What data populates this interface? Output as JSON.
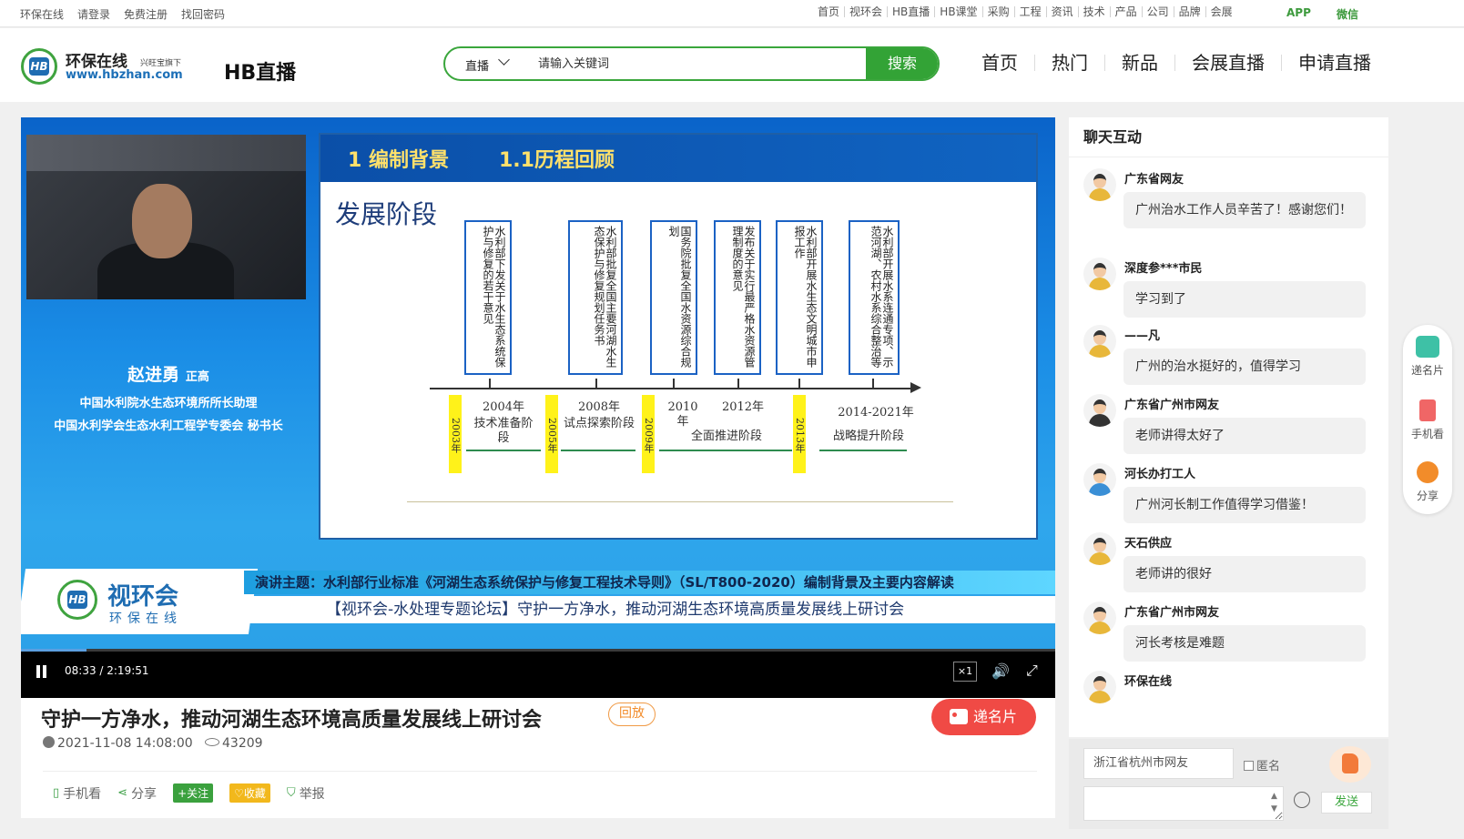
{
  "topbar": {
    "left_links": [
      "环保在线",
      "请登录",
      "免费注册",
      "找回密码"
    ],
    "right_links": [
      "首页",
      "视环会",
      "HB直播",
      "HB课堂",
      "采购",
      "工程",
      "资讯",
      "技术",
      "产品",
      "公司",
      "品牌",
      "会展"
    ],
    "app_label": "APP",
    "wechat_label": "微信"
  },
  "header": {
    "logo_name": "环保在线",
    "logo_sub": "兴旺宝旗下",
    "logo_url": "www.hbzhan.com",
    "section_title": "HB直播",
    "search": {
      "category": "直播",
      "placeholder": "请输入关键词",
      "button": "搜索"
    },
    "nav": [
      "首页",
      "热门",
      "新品",
      "会展直播",
      "申请直播"
    ]
  },
  "player": {
    "slide": {
      "heading1": "1 编制背景",
      "heading2": "1.1历程回顾",
      "stage_title": "发展阶段",
      "boxes": [
        "水利部下发关于水生态系统保护与修复的若干意见",
        "水利部批复全国主要河湖水生态保护与修复规划任务书",
        "国务院批复全国水资源综合规划",
        "发布关于实行最严格水资源管理制度的意见",
        "水利部开展水生态文明城市申报工作",
        "水利部开展水系连通专项、示范河湖、农村水系综合整治等"
      ],
      "years": [
        "2003年",
        "2005年",
        "2009年",
        "2013年"
      ],
      "phases": [
        {
          "year": "2004年",
          "name": "技术准备阶段"
        },
        {
          "year": "2008年",
          "name": "试点探索阶段"
        },
        {
          "year": "2010年",
          "name": ""
        },
        {
          "year": "2012年",
          "name": "全面推进阶段"
        },
        {
          "year": "2014-2021年",
          "name": "战略提升阶段"
        }
      ]
    },
    "speaker": {
      "name": "赵进勇",
      "rank": "正高",
      "title1": "中国水利院水生态环境所所长助理",
      "title2": "中国水利学会生态水利工程学专委会 秘书长"
    },
    "brand_main": "视环会",
    "brand_sub": "环保在线",
    "topic_line": "演讲主题：水利部行业标准《河湖生态系统保护与修复工程技术导则》（SL/T800-2020）编制背景及主要内容解读",
    "event_line": "【视环会-水处理专题论坛】守护一方净水，推动河湖生态环境高质量发展线上研讨会",
    "time_display": "08:33 / 2:19:51",
    "progress_fraction": 0.063,
    "rate": "×1"
  },
  "info": {
    "title": "守护一方净水，推动河湖生态环境高质量发展线上研讨会",
    "badge": "回放",
    "card_button": "递名片",
    "datetime": "2021-11-08 14:08:00",
    "views": "43209",
    "actions": {
      "mobile": "手机看",
      "share": "分享",
      "follow": "关注",
      "favorite": "收藏",
      "report": "举报"
    }
  },
  "chat": {
    "header": "聊天互动",
    "messages": [
      {
        "user": "广东省网友",
        "text": "广州治水工作人员辛苦了！感谢您们！"
      },
      {
        "user": "深度参***市民",
        "text": "学习到了"
      },
      {
        "user": "——凡",
        "text": "广州的治水挺好的，值得学习"
      },
      {
        "user": "广东省广州市网友",
        "text": "老师讲得太好了"
      },
      {
        "user": "河长办打工人",
        "text": "广州河长制工作值得学习借鉴！"
      },
      {
        "user": "天石供应",
        "text": "老师讲的很好"
      },
      {
        "user": "广东省广州市网友",
        "text": "河长考核是难题"
      },
      {
        "user": "环保在线",
        "text": ""
      }
    ],
    "nickname": "浙江省杭州市网友",
    "anonymous_label": "匿名",
    "send_button": "发送"
  },
  "sidebar": {
    "items": [
      "递名片",
      "手机看",
      "分享"
    ]
  }
}
